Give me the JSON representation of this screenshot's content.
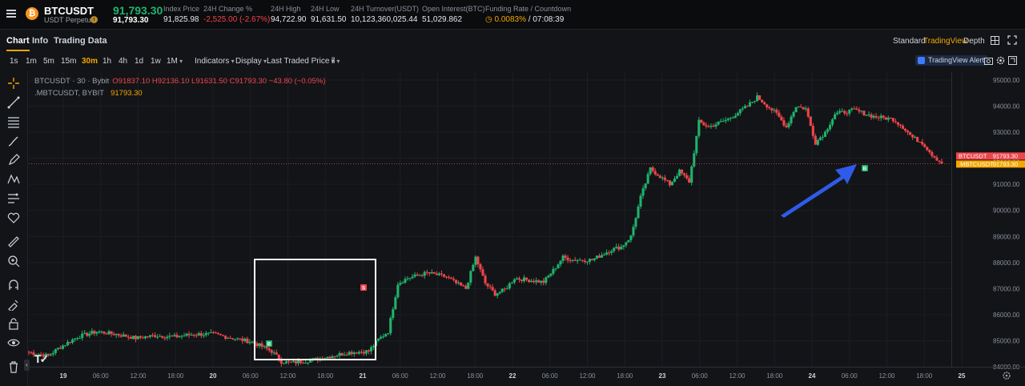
{
  "header": {
    "symbol": "BTCUSDT",
    "symbol_sub": "USDT Perpetual",
    "coin_glyph": "₿",
    "last_price": "91,793.30",
    "last_price_sub": "91,793.30",
    "stats": [
      {
        "label": "Index Price",
        "value": "91,825.98"
      },
      {
        "label": "24H Change %",
        "value": "-2,525.00 (-2.67%)"
      },
      {
        "label": "24H High",
        "value": "94,722.90"
      },
      {
        "label": "24H Low",
        "value": "91,631.50"
      },
      {
        "label": "24H Turnover(USDT)",
        "value": "10,123,360,025.44"
      },
      {
        "label": "Open Interest(BTC)",
        "value": "51,029.862"
      },
      {
        "label": "Funding Rate / Countdown",
        "value_rate": "0.0083%",
        "value_count": " / 07:08:39"
      }
    ]
  },
  "tabs": [
    {
      "label": "Chart"
    },
    {
      "label": "Info"
    },
    {
      "label": "Trading Data"
    }
  ],
  "views": [
    {
      "label": "Standard"
    },
    {
      "label": "TradingView"
    },
    {
      "label": "Depth"
    }
  ],
  "toolbar": {
    "timeframes": [
      "1s",
      "1m",
      "5m",
      "15m",
      "30m",
      "1h",
      "4h",
      "1d",
      "1w",
      "1M"
    ],
    "active_timeframe": "30m",
    "indicators": "Indicators",
    "display": "Display",
    "price_type": "Last Traded Price",
    "alert": "TradingView Alert"
  },
  "legend": {
    "line1_prefix": "BTCUSDT · 30 · Bybit",
    "ohlc": "O91837.10  H92136.10  L91631.50  C91793.30  −43.80 (−0.05%)",
    "line2_prefix": ".MBTCUSDT, BYBIT",
    "mark": "91793.30"
  },
  "price_tags": [
    {
      "name": "BTCUSDT",
      "value": "91793.30",
      "color": "#ef454a"
    },
    {
      "name": ".MBTCUSDT",
      "value": "91793.30",
      "color": "#f7a600"
    }
  ],
  "markers": {
    "buy": "B",
    "sell": "S"
  },
  "colors": {
    "up": "#20b26c",
    "down": "#ef454a",
    "accent": "#f7a600",
    "arrow": "#2f5be8",
    "box": "#ffffff"
  },
  "chart_data": {
    "type": "candlestick",
    "interval": "30m",
    "ylim": [
      83600,
      95400
    ],
    "y_ticks": [
      "95000.00",
      "94000.00",
      "93000.00",
      "92000.00",
      "91000.00",
      "90000.00",
      "89000.00",
      "88000.00",
      "87000.00",
      "86000.00",
      "85000.00",
      "84000.00"
    ],
    "x_ticks": [
      "19",
      "06:00",
      "12:00",
      "18:00",
      "20",
      "06:00",
      "12:00",
      "18:00",
      "21",
      "06:00",
      "12:00",
      "18:00",
      "22",
      "06:00",
      "12:00",
      "18:00",
      "23",
      "06:00",
      "12:00",
      "18:00",
      "24",
      "06:00",
      "12:00",
      "18:00",
      "25"
    ],
    "current_price": 91793.3,
    "anchors": [
      [
        0,
        84550
      ],
      [
        8,
        84420
      ],
      [
        12,
        84700
      ],
      [
        20,
        85150
      ],
      [
        28,
        85350
      ],
      [
        36,
        85250
      ],
      [
        44,
        85100
      ],
      [
        52,
        85200
      ],
      [
        60,
        85150
      ],
      [
        68,
        85250
      ],
      [
        76,
        85250
      ],
      [
        84,
        85100
      ],
      [
        92,
        84950
      ],
      [
        100,
        84600
      ],
      [
        104,
        84200
      ],
      [
        108,
        84150
      ],
      [
        116,
        84250
      ],
      [
        124,
        84400
      ],
      [
        132,
        84550
      ],
      [
        140,
        84600
      ],
      [
        144,
        85050
      ],
      [
        148,
        85350
      ],
      [
        152,
        87200
      ],
      [
        156,
        87400
      ],
      [
        164,
        87600
      ],
      [
        172,
        87450
      ],
      [
        176,
        87200
      ],
      [
        180,
        87000
      ],
      [
        184,
        88200
      ],
      [
        188,
        87200
      ],
      [
        192,
        86800
      ],
      [
        196,
        86950
      ],
      [
        200,
        87400
      ],
      [
        208,
        87300
      ],
      [
        212,
        87250
      ],
      [
        216,
        87700
      ],
      [
        220,
        88200
      ],
      [
        224,
        88100
      ],
      [
        232,
        88100
      ],
      [
        240,
        88500
      ],
      [
        244,
        88600
      ],
      [
        248,
        89000
      ],
      [
        252,
        90500
      ],
      [
        256,
        91600
      ],
      [
        264,
        91000
      ],
      [
        268,
        91500
      ],
      [
        272,
        91100
      ],
      [
        276,
        93400
      ],
      [
        280,
        93200
      ],
      [
        288,
        93500
      ],
      [
        296,
        94000
      ],
      [
        300,
        94350
      ],
      [
        308,
        93700
      ],
      [
        312,
        93200
      ],
      [
        316,
        94000
      ],
      [
        320,
        93900
      ],
      [
        324,
        92600
      ],
      [
        328,
        93000
      ],
      [
        332,
        93700
      ],
      [
        340,
        93850
      ],
      [
        348,
        93600
      ],
      [
        356,
        93500
      ],
      [
        360,
        93200
      ],
      [
        364,
        92800
      ],
      [
        368,
        92600
      ],
      [
        372,
        92150
      ],
      [
        376,
        91800
      ]
    ],
    "markers": [
      {
        "type": "buy",
        "x_time": "20 ~10:00",
        "price": 84150
      },
      {
        "type": "sell",
        "x_time": "21 ~00:30",
        "price": 86900
      },
      {
        "type": "buy",
        "x_time": "24 ~08:00",
        "price": 91550
      }
    ]
  }
}
